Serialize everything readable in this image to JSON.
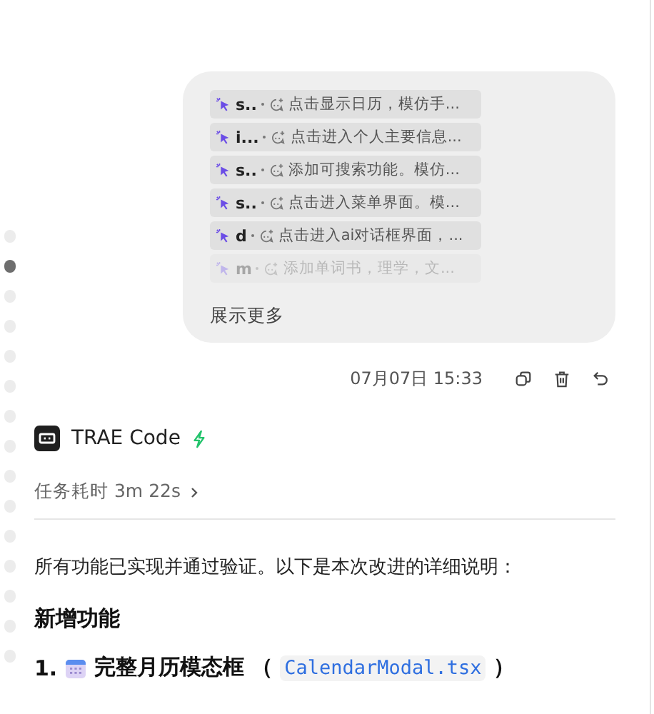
{
  "message_bubble": {
    "chips": [
      {
        "name": "s..",
        "text": "点击显示日历，模仿手...",
        "faded": false
      },
      {
        "name": "i...",
        "text": "点击进入个人主要信息...",
        "faded": false
      },
      {
        "name": "s..",
        "text": "添加可搜索功能。模仿...",
        "faded": false
      },
      {
        "name": "s..",
        "text": "点击进入菜单界面。模...",
        "faded": false
      },
      {
        "name": "d",
        "text": "点击进入ai对话框界面，...",
        "faded": false
      },
      {
        "name": "m",
        "text": "添加单词书，理学，文...",
        "faded": true
      }
    ],
    "show_more": "展示更多"
  },
  "timestamp": "07月07日 15:33",
  "timeline_dots": [
    {
      "selected": false
    },
    {
      "selected": true
    },
    {
      "selected": false
    },
    {
      "selected": false
    },
    {
      "selected": false
    },
    {
      "selected": false
    },
    {
      "selected": false
    },
    {
      "selected": false
    },
    {
      "selected": false
    },
    {
      "selected": false
    },
    {
      "selected": false
    },
    {
      "selected": false
    },
    {
      "selected": false
    },
    {
      "selected": false
    },
    {
      "selected": false
    }
  ],
  "agent": {
    "name": "TRAE Code"
  },
  "duration": "任务耗时 3m 22s",
  "summary": "所有功能已实现并通过验证。以下是本次改进的详细说明：",
  "heading": "新增功能",
  "list_item": {
    "number": "1.",
    "title": "完整月历模态框",
    "open_paren": "（",
    "code": "CalendarModal.tsx",
    "close_paren": "）"
  }
}
